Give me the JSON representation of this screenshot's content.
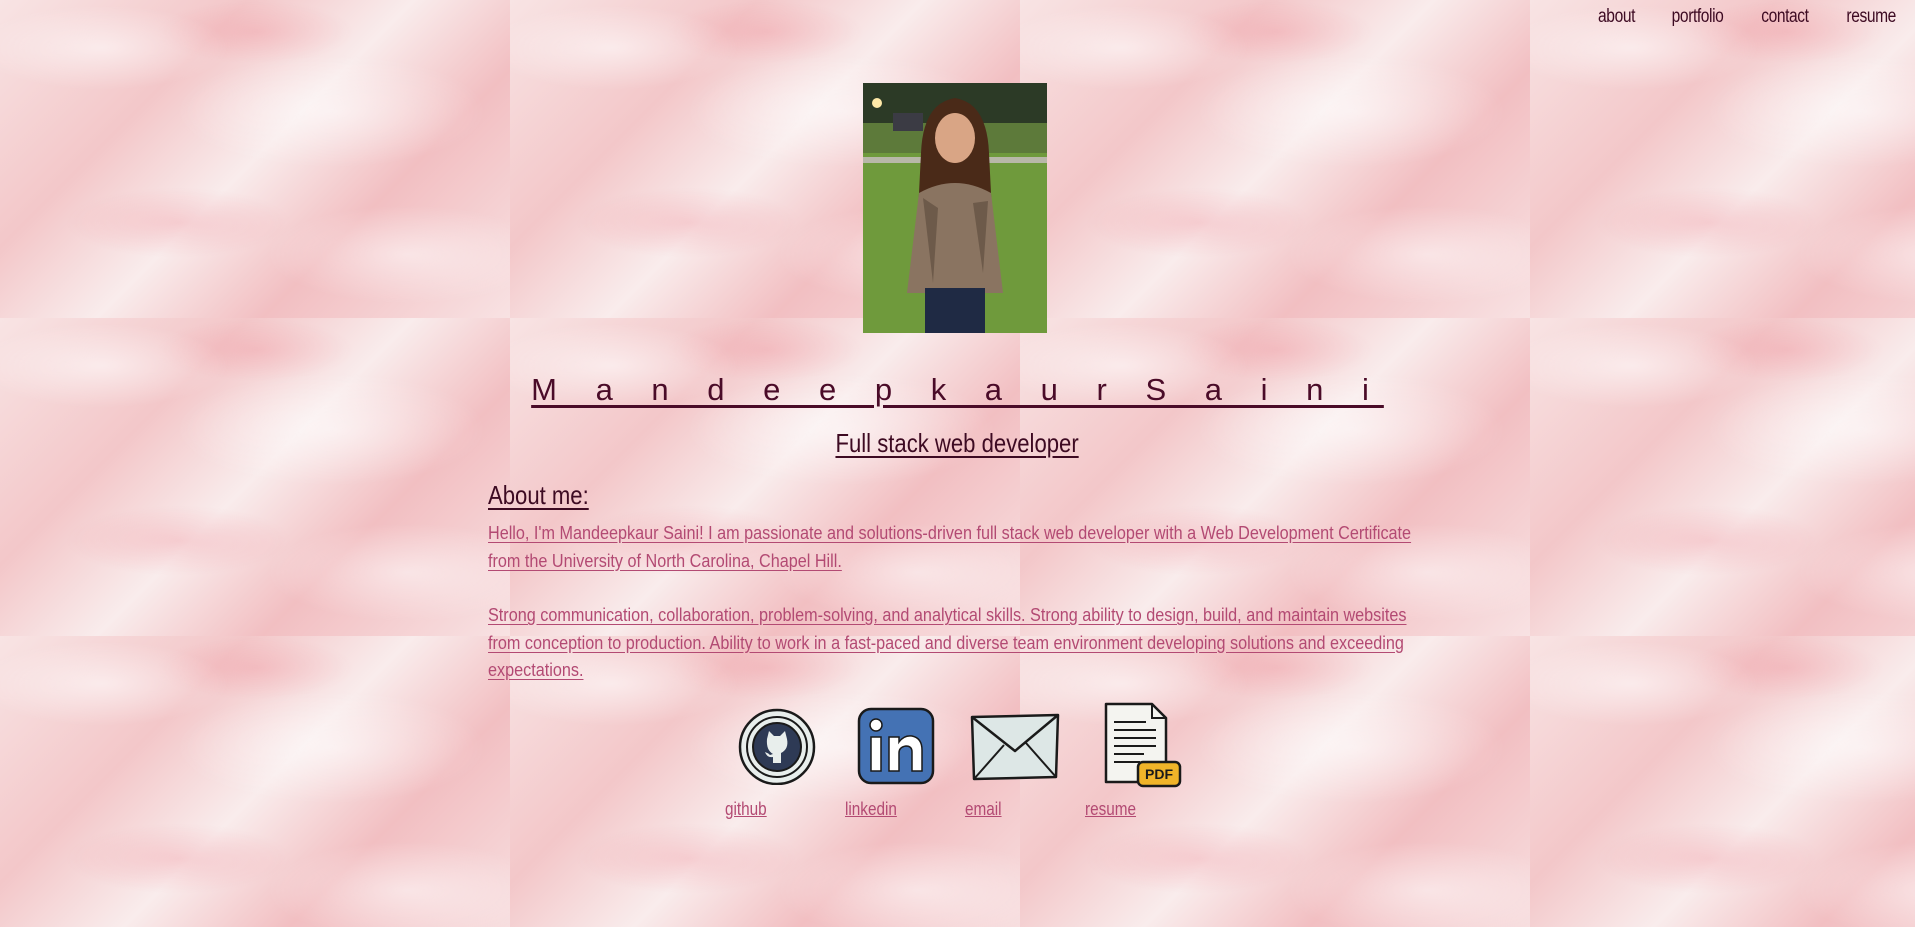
{
  "nav": {
    "items": [
      {
        "label": "about"
      },
      {
        "label": "portfolio"
      },
      {
        "label": "contact"
      },
      {
        "label": "resume"
      }
    ]
  },
  "profile": {
    "name": "M a n d e e p k a u r   S a i n i",
    "title": "Full stack web developer"
  },
  "about": {
    "heading": "About me:",
    "paragraph1": "Hello, I'm Mandeepkaur Saini! I am passionate and solutions-driven full stack web developer with a Web Development Certificate from the University of North Carolina, Chapel Hill.",
    "paragraph2": "Strong communication, collaboration, problem-solving, and analytical skills. Strong ability to design, build, and maintain websites from conception to production. Ability to work in a fast-paced and diverse team environment developing solutions and exceeding expectations."
  },
  "links": [
    {
      "label": "github",
      "icon": "github-icon"
    },
    {
      "label": "linkedin",
      "icon": "linkedin-icon"
    },
    {
      "label": "email",
      "icon": "envelope-icon"
    },
    {
      "label": "resume",
      "icon": "pdf-icon"
    }
  ],
  "colors": {
    "text_dark": "#3d0a22",
    "link_pink": "#b34a73",
    "background": "#f6d9da"
  }
}
